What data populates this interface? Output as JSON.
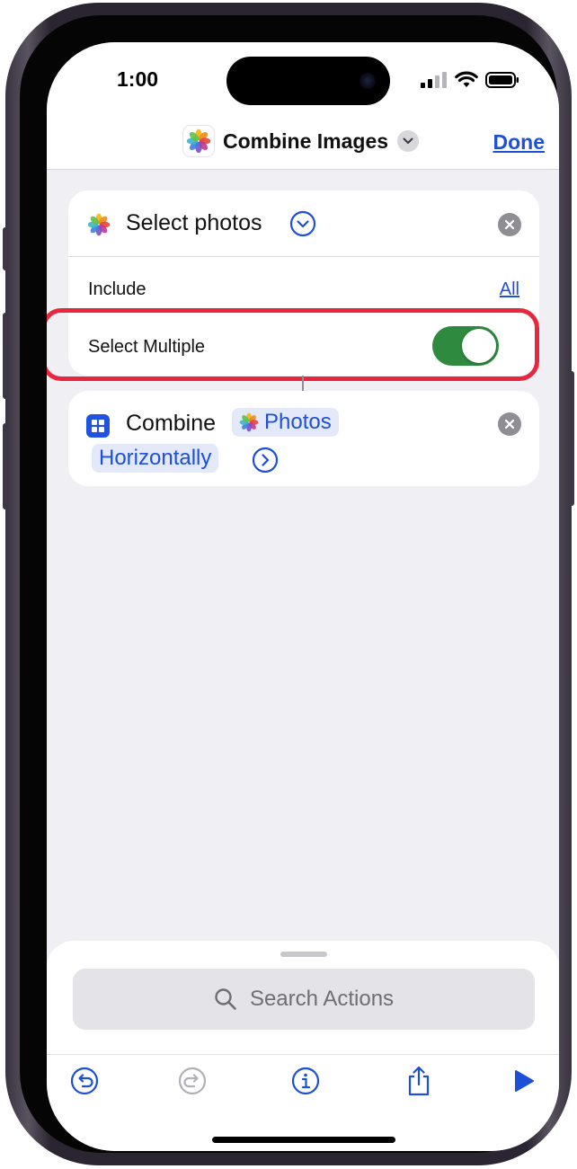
{
  "status_bar": {
    "time": "1:00"
  },
  "nav": {
    "title": "Combine Images",
    "done_label": "Done"
  },
  "select_action": {
    "title": "Select photos",
    "include_label": "Include",
    "include_value": "All",
    "multiple_label": "Select Multiple",
    "multiple_enabled": true
  },
  "combine_action": {
    "label": "Combine",
    "input_token": "Photos",
    "mode_token": "Horizontally"
  },
  "search": {
    "placeholder": "Search Actions"
  },
  "icons": {
    "app": "photos-icon",
    "toolbar": [
      "undo-icon",
      "redo-icon",
      "info-icon",
      "share-icon",
      "play-icon"
    ]
  },
  "colors": {
    "accent": "#1e4fd8",
    "toggle_on": "#2e8a3e",
    "highlight": "#e8273f",
    "disabled": "#b0b0b5"
  }
}
